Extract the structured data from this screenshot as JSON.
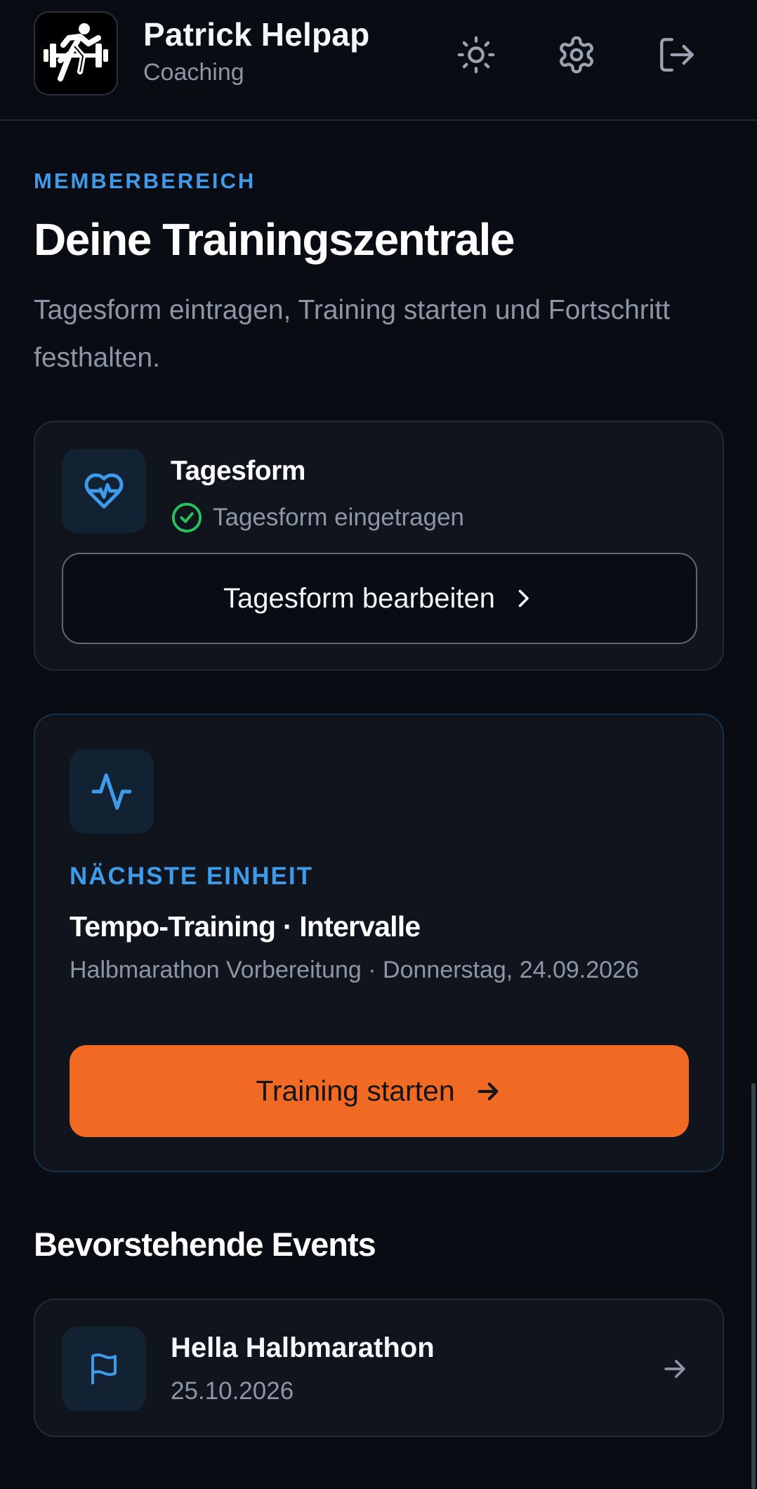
{
  "header": {
    "name": "Patrick Helpap",
    "subtitle": "Coaching"
  },
  "intro": {
    "eyebrow": "MEMBERBEREICH",
    "title": "Deine Trainingszentrale",
    "subtitle": "Tagesform eintragen, Training starten und Fortschritt festhalten."
  },
  "tagesform": {
    "title": "Tagesform",
    "status": "Tagesform eingetragen",
    "button_label": "Tagesform bearbeiten"
  },
  "next_unit": {
    "eyebrow": "NÄCHSTE EINHEIT",
    "title": "Tempo-Training · Intervalle",
    "meta": "Halbmarathon Vorbereitung · Donnerstag, 24.09.2026",
    "button_label": "Training starten"
  },
  "events": {
    "heading": "Bevorstehende Events",
    "items": [
      {
        "name": "Hella Halbmarathon",
        "date": "25.10.2026",
        "icon": "flag-icon"
      }
    ]
  },
  "colors": {
    "background": "#090c12",
    "card": "#10151d",
    "accent_blue": "#3d9be9",
    "accent_orange": "#f06a23",
    "success_green": "#22c55e",
    "muted_text": "#8d96a6"
  },
  "icons": {
    "logo": "runner-barbell-logo",
    "theme": "sun-icon",
    "settings": "gear-icon",
    "logout": "logout-icon",
    "tagesform": "heart-pulse-icon",
    "status": "check-circle-icon",
    "next_unit": "activity-icon"
  }
}
